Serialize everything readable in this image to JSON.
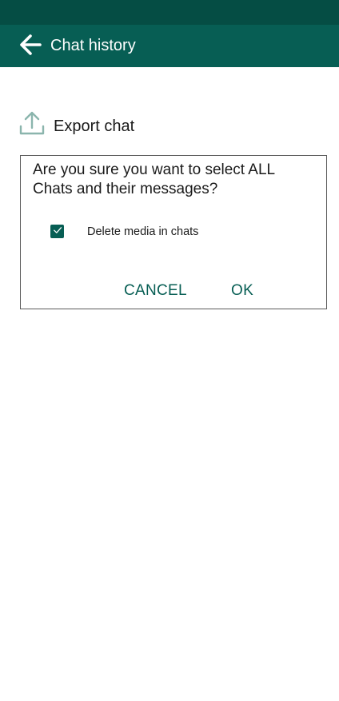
{
  "colors": {
    "status_bar": "#054d44",
    "app_bar": "#075e54",
    "accent": "#075e54",
    "export_icon": "#8bb5ad"
  },
  "header": {
    "back_icon": "arrow-left-icon",
    "title": "Chat history"
  },
  "export": {
    "icon": "upload-icon",
    "label": "Export chat"
  },
  "dialog": {
    "message": "Are you sure you want to select ALL Chats and their messages?",
    "checkbox": {
      "label": "Delete media in chats",
      "checked": true
    },
    "cancel_label": "CANCEL",
    "ok_label": "OK"
  }
}
